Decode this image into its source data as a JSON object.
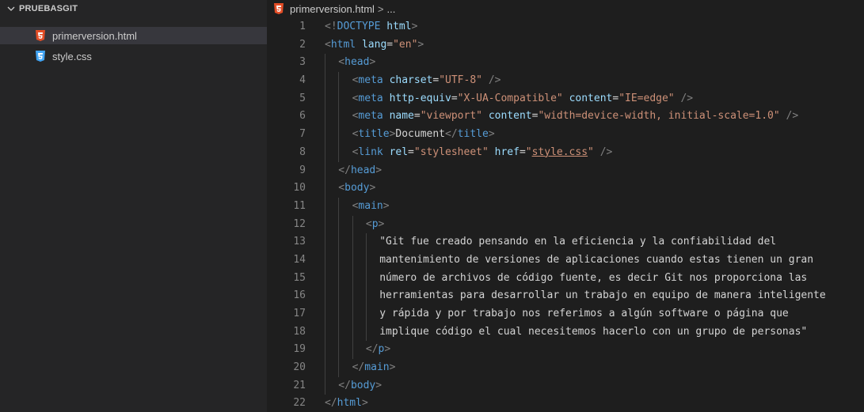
{
  "sidebar": {
    "folder_name": "PRUEBASGIT",
    "files": [
      {
        "name": "primerversion.html",
        "icon": "html5-file-icon",
        "icon_color": "#e44d26",
        "selected": true
      },
      {
        "name": "style.css",
        "icon": "css3-file-icon",
        "icon_color": "#42a5f5",
        "selected": false
      }
    ]
  },
  "editor": {
    "breadcrumb": {
      "file": "primerversion.html",
      "separator": ">",
      "trail": "..."
    },
    "colors": {
      "tag": "#569cd6",
      "punctuation": "#808080",
      "attribute": "#9cdcfe",
      "string": "#ce9178",
      "text": "#d4d4d4",
      "line_number": "#858585"
    },
    "lines": [
      {
        "n": "1",
        "indent": 0,
        "tokens": [
          [
            "punc",
            "<!"
          ],
          [
            "tag",
            "DOCTYPE"
          ],
          [
            "text",
            " "
          ],
          [
            "attr",
            "html"
          ],
          [
            "punc",
            ">"
          ]
        ]
      },
      {
        "n": "2",
        "indent": 0,
        "tokens": [
          [
            "punc",
            "<"
          ],
          [
            "tag",
            "html"
          ],
          [
            "text",
            " "
          ],
          [
            "attr",
            "lang"
          ],
          [
            "text",
            "="
          ],
          [
            "str",
            "\"en\""
          ],
          [
            "punc",
            ">"
          ]
        ]
      },
      {
        "n": "3",
        "indent": 1,
        "tokens": [
          [
            "punc",
            "<"
          ],
          [
            "tag",
            "head"
          ],
          [
            "punc",
            ">"
          ]
        ]
      },
      {
        "n": "4",
        "indent": 2,
        "tokens": [
          [
            "punc",
            "<"
          ],
          [
            "tag",
            "meta"
          ],
          [
            "text",
            " "
          ],
          [
            "attr",
            "charset"
          ],
          [
            "text",
            "="
          ],
          [
            "str",
            "\"UTF-8\""
          ],
          [
            "text",
            " "
          ],
          [
            "punc",
            "/>"
          ]
        ]
      },
      {
        "n": "5",
        "indent": 2,
        "tokens": [
          [
            "punc",
            "<"
          ],
          [
            "tag",
            "meta"
          ],
          [
            "text",
            " "
          ],
          [
            "attr",
            "http-equiv"
          ],
          [
            "text",
            "="
          ],
          [
            "str",
            "\"X-UA-Compatible\""
          ],
          [
            "text",
            " "
          ],
          [
            "attr",
            "content"
          ],
          [
            "text",
            "="
          ],
          [
            "str",
            "\"IE=edge\""
          ],
          [
            "text",
            " "
          ],
          [
            "punc",
            "/>"
          ]
        ]
      },
      {
        "n": "6",
        "indent": 2,
        "tokens": [
          [
            "punc",
            "<"
          ],
          [
            "tag",
            "meta"
          ],
          [
            "text",
            " "
          ],
          [
            "attr",
            "name"
          ],
          [
            "text",
            "="
          ],
          [
            "str",
            "\"viewport\""
          ],
          [
            "text",
            " "
          ],
          [
            "attr",
            "content"
          ],
          [
            "text",
            "="
          ],
          [
            "str",
            "\"width=device-width, initial-scale=1.0\""
          ],
          [
            "text",
            " "
          ],
          [
            "punc",
            "/>"
          ]
        ]
      },
      {
        "n": "7",
        "indent": 2,
        "tokens": [
          [
            "punc",
            "<"
          ],
          [
            "tag",
            "title"
          ],
          [
            "punc",
            ">"
          ],
          [
            "text",
            "Document"
          ],
          [
            "punc",
            "</"
          ],
          [
            "tag",
            "title"
          ],
          [
            "punc",
            ">"
          ]
        ]
      },
      {
        "n": "8",
        "indent": 2,
        "tokens": [
          [
            "punc",
            "<"
          ],
          [
            "tag",
            "link"
          ],
          [
            "text",
            " "
          ],
          [
            "attr",
            "rel"
          ],
          [
            "text",
            "="
          ],
          [
            "str",
            "\"stylesheet\""
          ],
          [
            "text",
            " "
          ],
          [
            "attr",
            "href"
          ],
          [
            "text",
            "="
          ],
          [
            "str",
            "\""
          ],
          [
            "link",
            "style.css"
          ],
          [
            "str",
            "\""
          ],
          [
            "text",
            " "
          ],
          [
            "punc",
            "/>"
          ]
        ]
      },
      {
        "n": "9",
        "indent": 1,
        "tokens": [
          [
            "punc",
            "</"
          ],
          [
            "tag",
            "head"
          ],
          [
            "punc",
            ">"
          ]
        ]
      },
      {
        "n": "10",
        "indent": 1,
        "tokens": [
          [
            "punc",
            "<"
          ],
          [
            "tag",
            "body"
          ],
          [
            "punc",
            ">"
          ]
        ]
      },
      {
        "n": "11",
        "indent": 2,
        "tokens": [
          [
            "punc",
            "<"
          ],
          [
            "tag",
            "main"
          ],
          [
            "punc",
            ">"
          ]
        ]
      },
      {
        "n": "12",
        "indent": 3,
        "tokens": [
          [
            "punc",
            "<"
          ],
          [
            "tag",
            "p"
          ],
          [
            "punc",
            ">"
          ]
        ]
      },
      {
        "n": "13",
        "indent": 4,
        "tokens": [
          [
            "text",
            "\"Git fue creado pensando en la eficiencia y la confiabilidad del"
          ]
        ]
      },
      {
        "n": "14",
        "indent": 4,
        "tokens": [
          [
            "text",
            "mantenimiento de versiones de aplicaciones cuando estas tienen un gran"
          ]
        ]
      },
      {
        "n": "15",
        "indent": 4,
        "tokens": [
          [
            "text",
            "número de archivos de código fuente, es decir Git nos proporciona las"
          ]
        ]
      },
      {
        "n": "16",
        "indent": 4,
        "tokens": [
          [
            "text",
            "herramientas para desarrollar un trabajo en equipo de manera inteligente"
          ]
        ]
      },
      {
        "n": "17",
        "indent": 4,
        "tokens": [
          [
            "text",
            "y rápida y por trabajo nos referimos a algún software o página que"
          ]
        ]
      },
      {
        "n": "18",
        "indent": 4,
        "tokens": [
          [
            "text",
            "implique código el cual necesitemos hacerlo con un grupo de personas\""
          ]
        ]
      },
      {
        "n": "19",
        "indent": 3,
        "tokens": [
          [
            "punc",
            "</"
          ],
          [
            "tag",
            "p"
          ],
          [
            "punc",
            ">"
          ]
        ]
      },
      {
        "n": "20",
        "indent": 2,
        "tokens": [
          [
            "punc",
            "</"
          ],
          [
            "tag",
            "main"
          ],
          [
            "punc",
            ">"
          ]
        ]
      },
      {
        "n": "21",
        "indent": 1,
        "tokens": [
          [
            "punc",
            "</"
          ],
          [
            "tag",
            "body"
          ],
          [
            "punc",
            ">"
          ]
        ]
      },
      {
        "n": "22",
        "indent": 0,
        "tokens": [
          [
            "punc",
            "</"
          ],
          [
            "tag",
            "html"
          ],
          [
            "punc",
            ">"
          ]
        ]
      }
    ]
  }
}
